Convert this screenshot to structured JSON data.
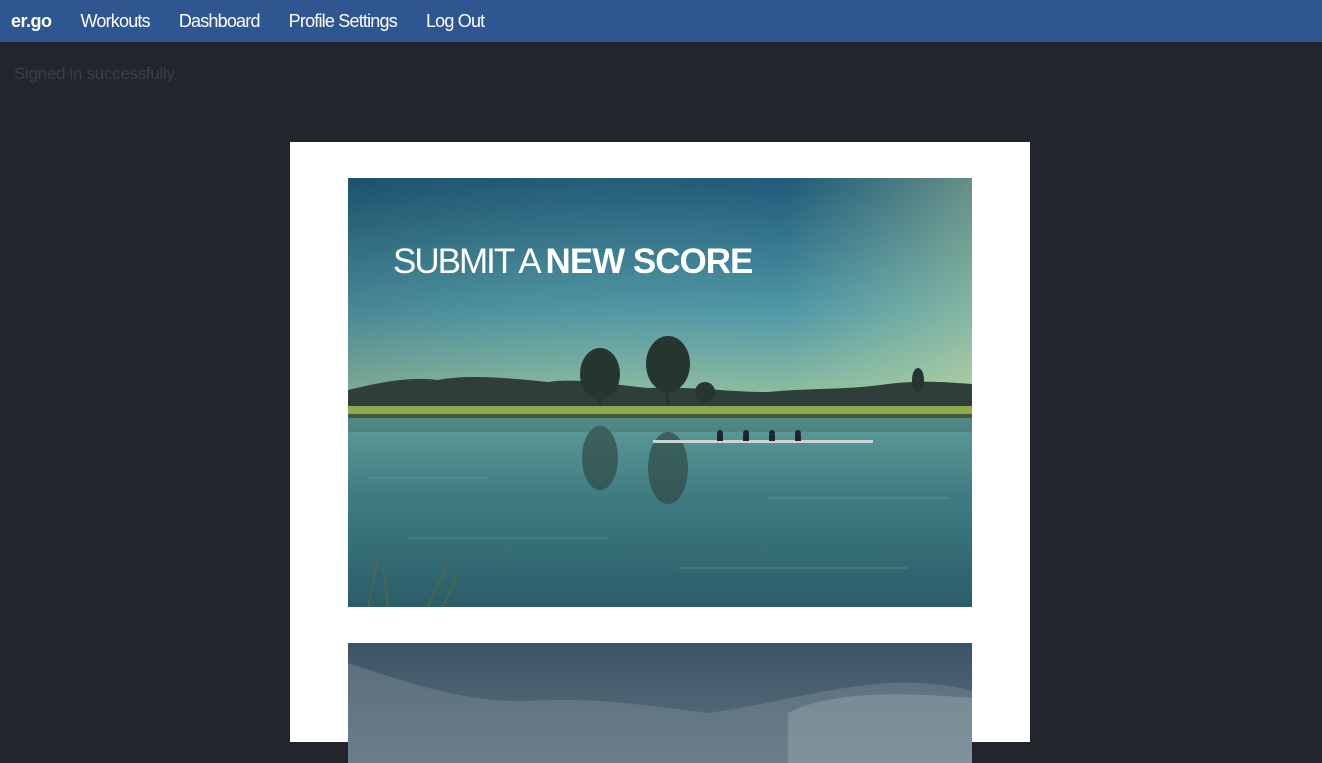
{
  "nav": {
    "brand": "er.go",
    "items": [
      {
        "label": "Workouts"
      },
      {
        "label": "Dashboard"
      },
      {
        "label": "Profile Settings"
      },
      {
        "label": "Log Out"
      }
    ]
  },
  "flash": {
    "message": "Signed in successfully."
  },
  "cards": [
    {
      "title_light": "SUBMIT A",
      "title_bold": "NEW SCORE"
    }
  ],
  "colors": {
    "navbar": "#305691",
    "page_background": "#22252b",
    "panel": "#ffffff"
  }
}
